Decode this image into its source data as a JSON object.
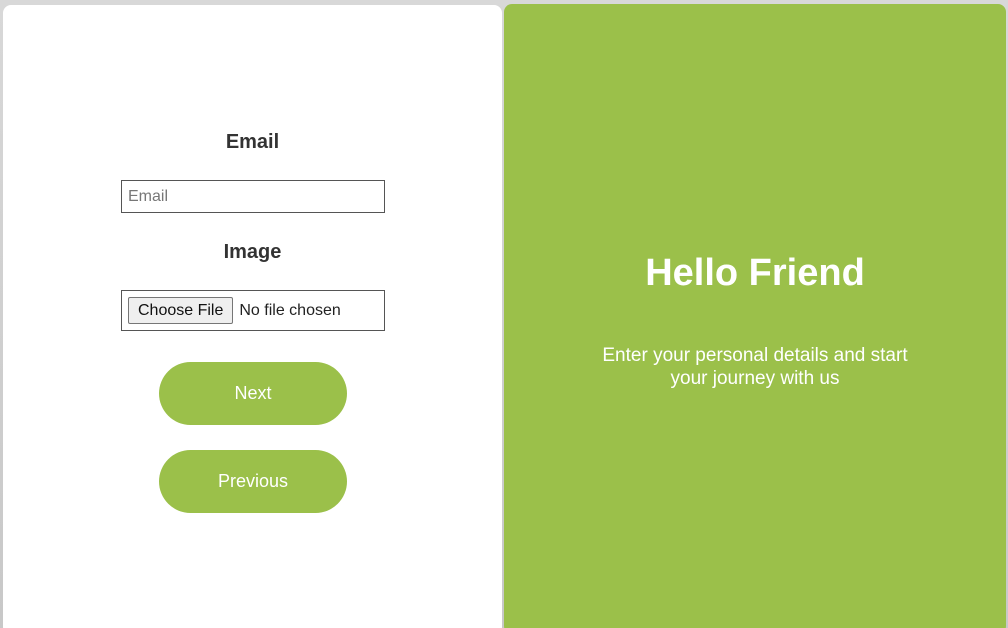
{
  "form": {
    "email_label": "Email",
    "email_placeholder": "Email",
    "email_value": "",
    "image_label": "Image",
    "file_button_label": "Choose File",
    "file_status": "No file chosen",
    "next_label": "Next",
    "previous_label": "Previous"
  },
  "welcome": {
    "title": "Hello Friend",
    "text": "Enter your personal details and start your journey with us"
  },
  "colors": {
    "accent": "#9bc04a",
    "panel_bg": "#ffffff",
    "label_text": "#333333"
  }
}
